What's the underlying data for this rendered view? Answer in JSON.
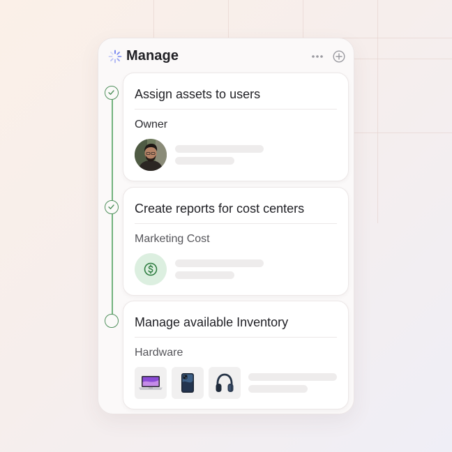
{
  "panel": {
    "title": "Manage",
    "header_icons": [
      "spinner-icon",
      "more-horizontal-icon",
      "plus-circle-icon"
    ]
  },
  "steps": [
    {
      "title": "Assign assets to users",
      "subtitle": "Owner",
      "status": "completed",
      "media": "avatar"
    },
    {
      "title": "Create reports for cost centers",
      "subtitle": "Marketing Cost",
      "status": "completed",
      "media": "dollar-icon"
    },
    {
      "title": "Manage available Inventory",
      "subtitle": "Hardware",
      "status": "pending",
      "media": [
        "laptop-icon",
        "phone-icon",
        "headphones-icon"
      ]
    }
  ],
  "colors": {
    "accent_green": "#4f8f5c",
    "timeline_green": "#72b27d",
    "dollar_bg": "#dcefe0",
    "spinner": "#6b7cf0"
  }
}
